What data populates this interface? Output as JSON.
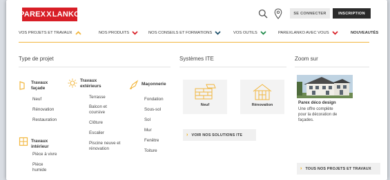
{
  "header": {
    "logo_text_left": "PAREX",
    "logo_text_x": "X",
    "logo_text_right": "LANKO",
    "login_label": "SE CONNECTER",
    "signup_label": "INSCRIPTION",
    "icons": [
      "search-icon",
      "location-pin-icon"
    ]
  },
  "nav": {
    "items": [
      {
        "label": "VOS PROJETS ET TRAVAUX",
        "chevron": "up",
        "chevron_color": "#f2b63c"
      },
      {
        "label": "NOS PRODUITS",
        "chevron": "down",
        "chevron_color": "#d81e26"
      },
      {
        "label": "NOS CONSEILS ET FORMATIONS",
        "chevron": "down",
        "chevron_color": "#1c4f6b"
      },
      {
        "label": "VOS OUTILS",
        "chevron": "down",
        "chevron_color": "#1e8a4a"
      },
      {
        "label": "PAREXLANKO AVEC VOUS",
        "chevron": "down",
        "chevron_color": "#d81e26"
      },
      {
        "label": "NOUVEAUTÉS",
        "chevron": null
      }
    ]
  },
  "type_projet": {
    "title": "Type de projet",
    "categories": [
      {
        "title_lines": [
          "Travaux",
          "façade"
        ],
        "icon": "facade-icon",
        "items": [
          "Neuf",
          "Rénovation",
          "Restauration"
        ]
      },
      {
        "title_lines": [
          "Travaux",
          "extérieurs"
        ],
        "icon": "sun-icon",
        "items": [
          "Terrasse",
          "Balcon et coursive",
          "Clôture",
          "Escalier",
          "Piscine neuve et rénovation"
        ]
      },
      {
        "title_lines": [
          "Maçonnerie"
        ],
        "icon": "trowel-icon",
        "items": [
          "Fondation",
          "Sous-sol",
          "Sol",
          "Mur",
          "Fenêtre",
          "Toiture"
        ]
      },
      {
        "title_lines": [
          "Travaux",
          "intérieur"
        ],
        "icon": "window-icon",
        "items": [
          "Pièce à vivre",
          "Pièce humide"
        ]
      }
    ]
  },
  "systemes_ite": {
    "title": "Systèmes ITE",
    "cards": [
      {
        "label": "Neuf",
        "icon": "bricks-icon"
      },
      {
        "label": "Rénovation",
        "icon": "house-icon"
      }
    ],
    "cta_label": "VOIR NOS SOLUTIONS ITE"
  },
  "zoom_sur": {
    "title": "Zoom sur",
    "card_title": "Parex déco design",
    "card_text_lines": [
      "Une offre complète",
      "pour la décoration de",
      "façades."
    ],
    "cta_label": "TOUS NOS PROJETS ET TRAVAUX"
  },
  "colors": {
    "brand_red": "#d81e26",
    "accent_yellow": "#f2b63c",
    "dark_button": "#2b2b2b"
  }
}
